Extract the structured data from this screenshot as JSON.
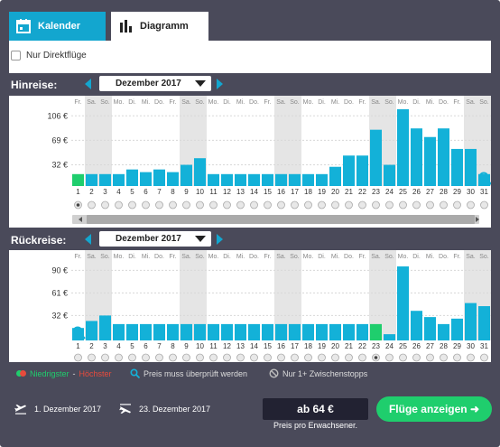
{
  "tabs": {
    "calendar": "Kalender",
    "diagram": "Diagramm"
  },
  "direct_flights": "Nur Direktflüge",
  "outbound": {
    "label": "Hinreise:",
    "month": "Dezember 2017"
  },
  "return": {
    "label": "Rückreise:",
    "month": "Dezember 2017"
  },
  "weekdays": [
    "Fr.",
    "Sa.",
    "So.",
    "Mo.",
    "Di.",
    "Mi.",
    "Do.",
    "Fr.",
    "Sa.",
    "So.",
    "Mo.",
    "Di.",
    "Mi.",
    "Do.",
    "Fr.",
    "Sa.",
    "So.",
    "Mo.",
    "Di.",
    "Mi.",
    "Do.",
    "Fr.",
    "Sa.",
    "So.",
    "Mo.",
    "Di.",
    "Mi.",
    "Do.",
    "Fr.",
    "Sa.",
    "So."
  ],
  "days": [
    "1",
    "2",
    "3",
    "4",
    "5",
    "6",
    "7",
    "8",
    "9",
    "10",
    "11",
    "12",
    "13",
    "14",
    "15",
    "16",
    "17",
    "18",
    "19",
    "20",
    "21",
    "22",
    "23",
    "24",
    "25",
    "26",
    "27",
    "28",
    "29",
    "30",
    "31"
  ],
  "colors": {
    "bar": "#13b1d8",
    "lowest": "#1fce6d",
    "highest": "#e84b3c",
    "weekend_bg": "#e5e5e5"
  },
  "chart_data": [
    {
      "type": "bar",
      "name": "outbound",
      "yticks": [
        "106 €",
        "69 €",
        "32 €"
      ],
      "ytick_values": [
        106,
        69,
        32
      ],
      "values": [
        18,
        18,
        18,
        18,
        25,
        21,
        25,
        21,
        32,
        42,
        18,
        18,
        18,
        18,
        18,
        18,
        18,
        18,
        18,
        29,
        46,
        46,
        85,
        32,
        116,
        87,
        74,
        87,
        56,
        56,
        18
      ],
      "lowest_day": 1,
      "selected_day": 1,
      "search_icon_day": 31
    },
    {
      "type": "bar",
      "name": "return",
      "yticks": [
        "90 €",
        "61 €",
        "32 €"
      ],
      "ytick_values": [
        90,
        61,
        32
      ],
      "values": [
        16,
        25,
        32,
        21,
        21,
        21,
        21,
        21,
        21,
        21,
        21,
        21,
        21,
        21,
        21,
        21,
        21,
        21,
        21,
        21,
        21,
        21,
        21,
        8,
        95,
        38,
        30,
        21,
        28,
        48,
        44
      ],
      "lowest_day": 23,
      "selected_day": 23,
      "search_icon_day": 1
    }
  ],
  "legend": {
    "lowest": "Niedrigster",
    "separator": " - ",
    "highest": "Höchster",
    "check": "Preis muss überprüft werden",
    "stops": "Nur 1+ Zwischenstopps"
  },
  "trip": {
    "depart_date": "1. Dezember 2017",
    "return_date": "23. Dezember 2017"
  },
  "price": {
    "value": "ab 64 €",
    "note": "Preis pro Erwachsener."
  },
  "cta": "Flüge anzeigen ➜"
}
